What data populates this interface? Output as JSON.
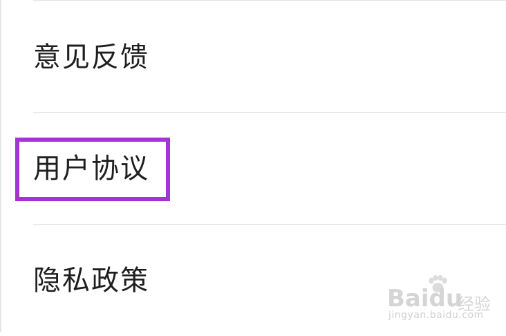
{
  "settings_menu": {
    "items": [
      {
        "label": "意见反馈"
      },
      {
        "label": "用户协议"
      },
      {
        "label": "隐私政策"
      }
    ]
  },
  "watermark": {
    "brand": "Baidu",
    "subtitle": "经验",
    "url": "jingyan.baidu.com"
  },
  "colors": {
    "text": "#1f1f1f",
    "divider": "#e4e4e4",
    "highlight": "#a633d6",
    "background": "#ffffff"
  }
}
